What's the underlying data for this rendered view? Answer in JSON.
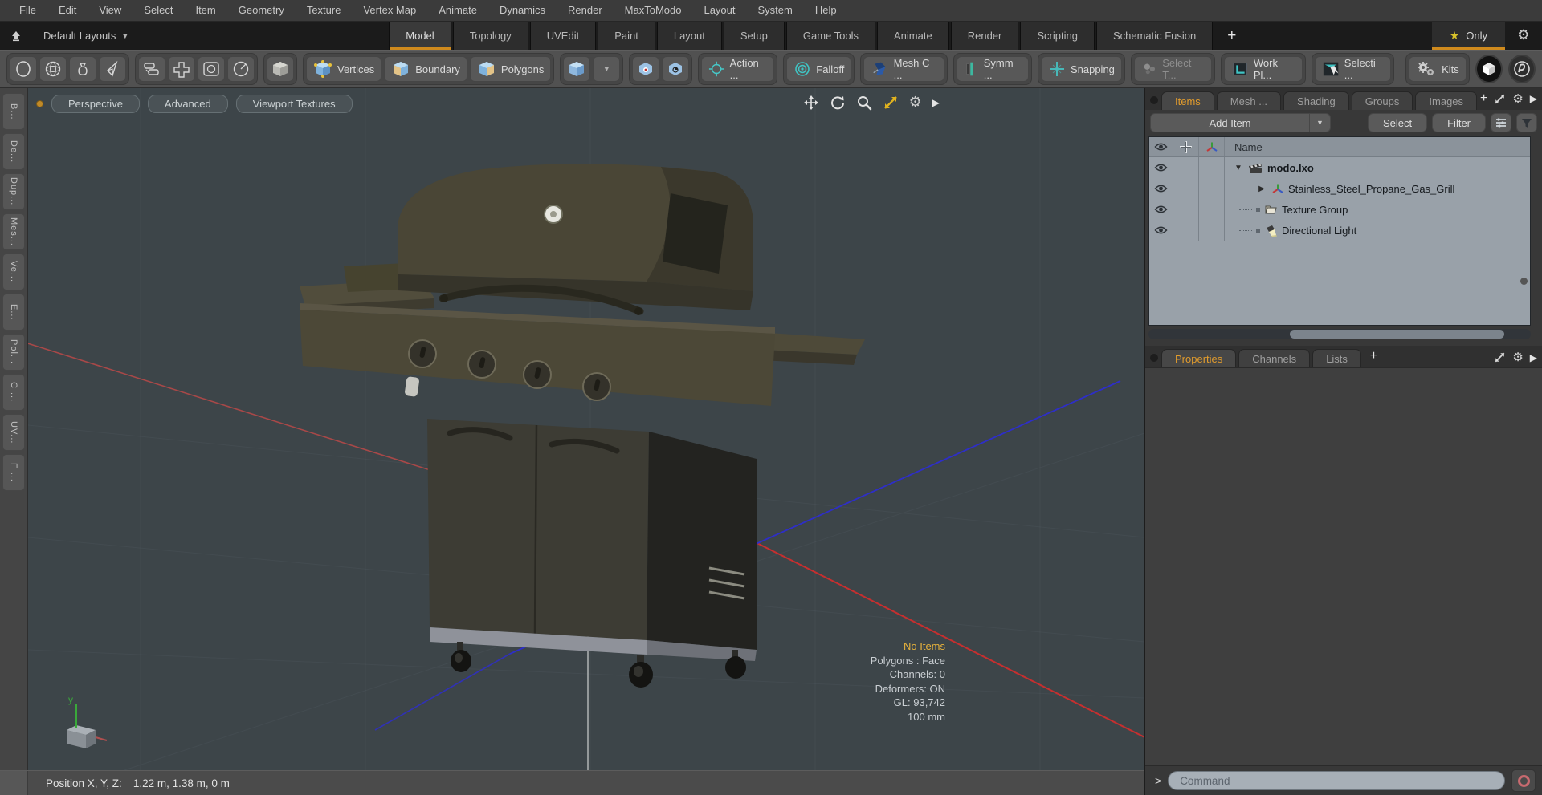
{
  "menu_bar": {
    "items": [
      "File",
      "Edit",
      "View",
      "Select",
      "Item",
      "Geometry",
      "Texture",
      "Vertex Map",
      "Animate",
      "Dynamics",
      "Render",
      "MaxToModo",
      "Layout",
      "System",
      "Help"
    ]
  },
  "layout_bar": {
    "default_layouts_label": "Default Layouts",
    "tabs": [
      "Model",
      "Topology",
      "UVEdit",
      "Paint",
      "Layout",
      "Setup",
      "Game Tools",
      "Animate",
      "Render",
      "Scripting",
      "Schematic Fusion"
    ],
    "active_tab": "Model",
    "add_tab_label": "+",
    "star": "★",
    "only_label": "Only"
  },
  "toolbar": {
    "vertices_label": "Vertices",
    "boundary_label": "Boundary",
    "polygons_label": "Polygons",
    "action_label": "Action  ...",
    "falloff_label": "Falloff",
    "mesh_constraint_label": "Mesh C ...",
    "symmetry_label": "Symm ...",
    "snapping_label": "Snapping",
    "select_through_label": "Select T...",
    "work_plane_label": "Work Pl...",
    "selection_sets_label": "Selecti ...",
    "kits_label": "Kits"
  },
  "left_tabs": {
    "items": [
      "B...",
      "De...",
      "Dup...",
      "Mes...",
      "Ve...",
      "E...",
      "Pol...",
      "C ...",
      "UV...",
      "F ..."
    ]
  },
  "viewport": {
    "perspective_label": "Perspective",
    "advanced_label": "Advanced",
    "viewport_textures_label": "Viewport Textures",
    "stats": {
      "selection": "No Items",
      "polygons": "Polygons : Face",
      "channels": "Channels: 0",
      "deformers": "Deformers: ON",
      "gl": "GL: 93,742",
      "grid_size": "100 mm"
    },
    "axis_gizmo_y_label": "y"
  },
  "item_panel": {
    "tabs": [
      "Items",
      "Mesh ...",
      "Shading",
      "Groups",
      "Images"
    ],
    "active_tab": "Items",
    "add_tab_label": "+",
    "add_item_label": "Add Item",
    "select_label": "Select",
    "filter_label": "Filter",
    "name_column": "Name",
    "rows": [
      {
        "name": "modo.lxo"
      },
      {
        "name": "Stainless_Steel_Propane_Gas_Grill"
      },
      {
        "name": "Texture Group"
      },
      {
        "name": "Directional Light"
      }
    ]
  },
  "properties_panel": {
    "tabs": [
      "Properties",
      "Channels",
      "Lists"
    ],
    "add_tab_label": "+",
    "active_tab": "Properties"
  },
  "command_bar": {
    "prompt": ">",
    "placeholder": "Command"
  },
  "status_bar": {
    "label": "Position X, Y, Z:",
    "value": "1.22 m, 1.38 m, 0 m"
  },
  "colors": {
    "accent_orange": "#cf8a1d",
    "viewport_bg": "#3d4549",
    "tree_bg": "#99a1a9",
    "axis_x_red": "#c23a3a",
    "axis_z_blue": "#2b2bd0"
  }
}
